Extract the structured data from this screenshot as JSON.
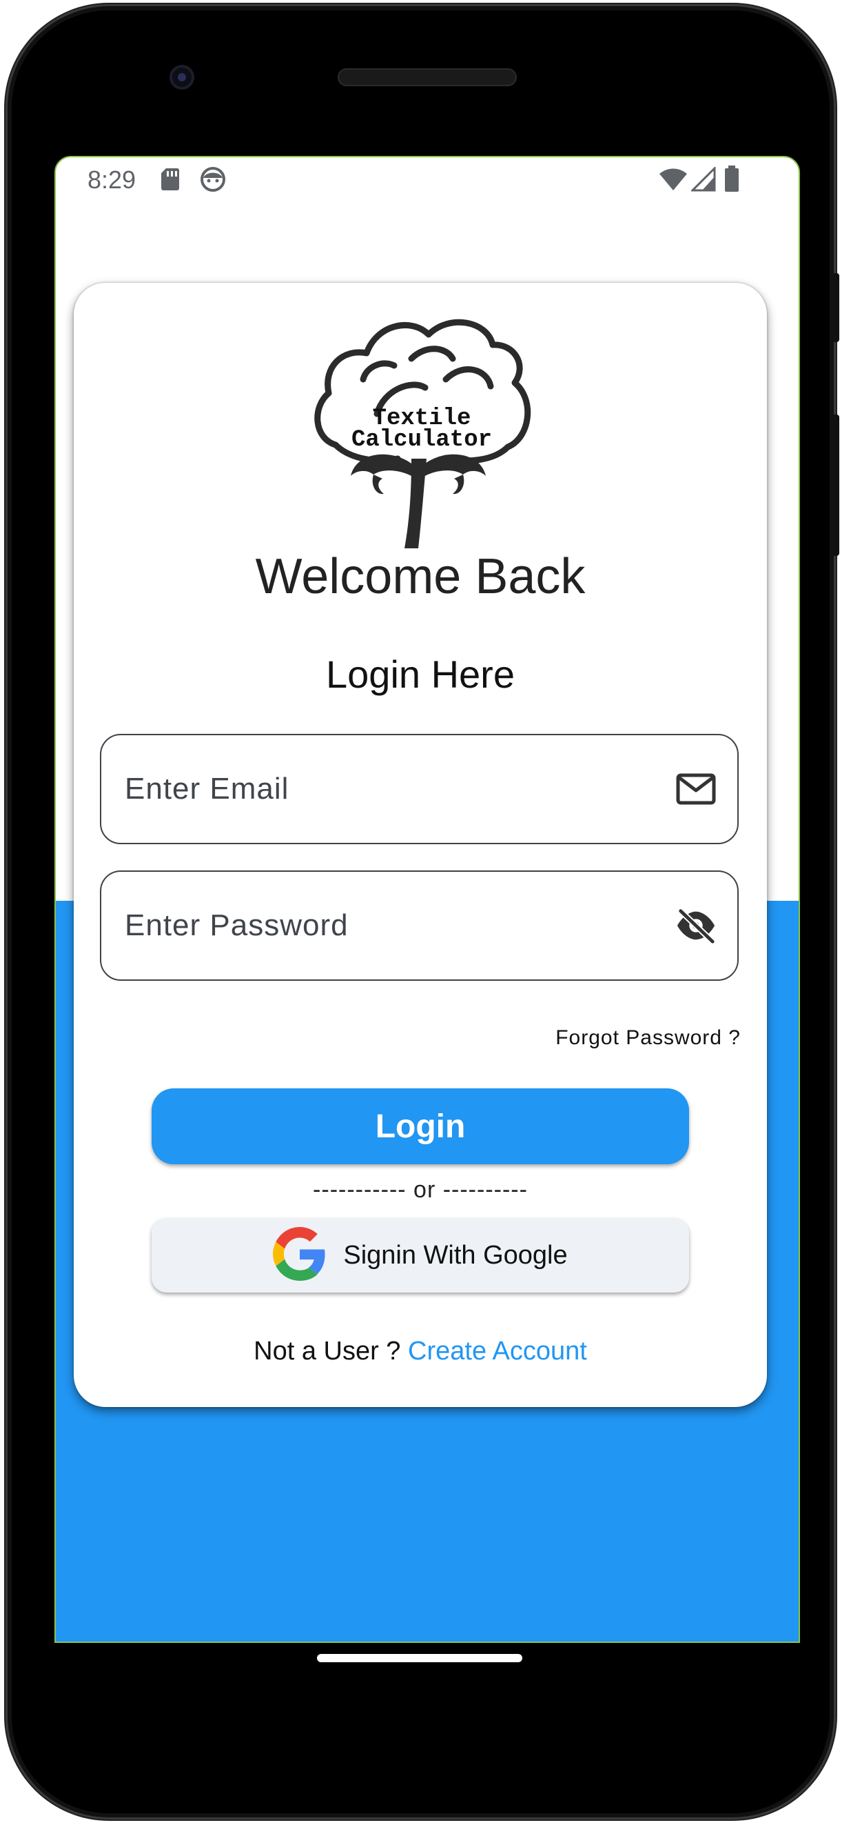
{
  "status_bar": {
    "time": "8:29"
  },
  "logo": {
    "line1": "Textile",
    "line2": "Calculator"
  },
  "welcome_title": "Welcome Back",
  "login_heading": "Login Here",
  "email_field": {
    "placeholder": "Enter Email",
    "icon": "mail-icon"
  },
  "password_field": {
    "placeholder": "Enter Password",
    "icon": "visibility-off-icon"
  },
  "forgot_password": "Forgot Password ?",
  "login_button": "Login",
  "divider": "----------- or ----------",
  "google_button": {
    "label": "Signin With Google",
    "icon": "google-icon"
  },
  "signup_prompt": {
    "text": "Not a User ?",
    "link": "Create Account"
  },
  "colors": {
    "primary": "#2196f3",
    "accent_border": "#8bc34a",
    "google_bg": "#eef2f7"
  }
}
